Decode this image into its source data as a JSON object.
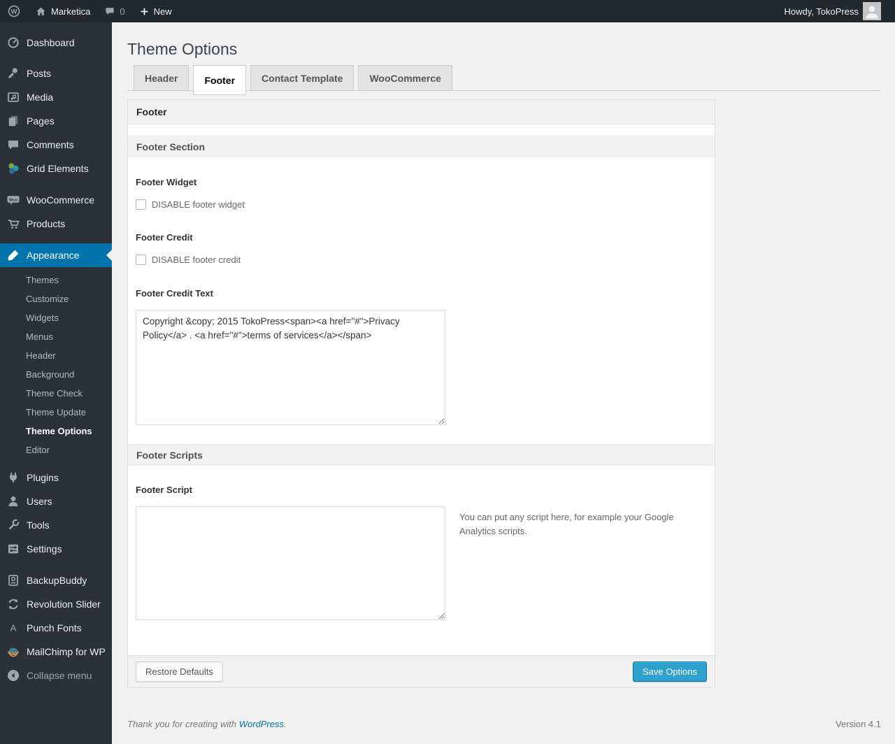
{
  "admin_bar": {
    "site_name": "Marketica",
    "comments_count": "0",
    "new_label": "New",
    "howdy": "Howdy, TokoPress"
  },
  "sidebar": {
    "menu": [
      {
        "label": "Dashboard"
      },
      {
        "label": "Posts"
      },
      {
        "label": "Media"
      },
      {
        "label": "Pages"
      },
      {
        "label": "Comments"
      },
      {
        "label": "Grid Elements"
      },
      {
        "label": "WooCommerce"
      },
      {
        "label": "Products"
      },
      {
        "label": "Appearance"
      },
      {
        "label": "Plugins"
      },
      {
        "label": "Users"
      },
      {
        "label": "Tools"
      },
      {
        "label": "Settings"
      },
      {
        "label": "BackupBuddy"
      },
      {
        "label": "Revolution Slider"
      },
      {
        "label": "Punch Fonts"
      },
      {
        "label": "MailChimp for WP"
      },
      {
        "label": "Collapse menu"
      }
    ],
    "active_item": "Appearance",
    "appearance_submenu": [
      "Themes",
      "Customize",
      "Widgets",
      "Menus",
      "Header",
      "Background",
      "Theme Check",
      "Theme Update",
      "Theme Options",
      "Editor"
    ],
    "active_submenu_item": "Theme Options"
  },
  "content": {
    "title": "Theme Options",
    "tabs": [
      {
        "label": "Header"
      },
      {
        "label": "Footer"
      },
      {
        "label": "Contact Template"
      },
      {
        "label": "WooCommerce"
      }
    ],
    "active_tab": "Footer",
    "panel_heading": "Footer",
    "footer_section": {
      "title": "Footer Section",
      "footer_widget": {
        "label": "Footer Widget",
        "checkbox_label": "DISABLE footer widget",
        "checked": false
      },
      "footer_credit": {
        "label": "Footer Credit",
        "checkbox_label": "DISABLE footer credit",
        "checked": false
      },
      "footer_credit_text": {
        "label": "Footer Credit Text",
        "value": "Copyright &copy; 2015 TokoPress<span><a href=\"#\">Privacy Policy</a> . <a href=\"#\">terms of services</a></span>"
      }
    },
    "footer_scripts": {
      "title": "Footer Scripts",
      "footer_script": {
        "label": "Footer Script",
        "value": "",
        "help": "You can put any script here, for example your Google Analytics scripts."
      }
    },
    "buttons": {
      "restore": "Restore Defaults",
      "save": "Save Options"
    }
  },
  "page_footer": {
    "thanks_prefix": "Thank you for creating with ",
    "wordpress_link": "WordPress",
    "thanks_suffix": ".",
    "version": "Version 4.1"
  },
  "colors": {
    "accent": "#0073aa",
    "button_primary": "#2ea2cc",
    "link": "#0074a2",
    "admin_dark": "#23282d"
  }
}
